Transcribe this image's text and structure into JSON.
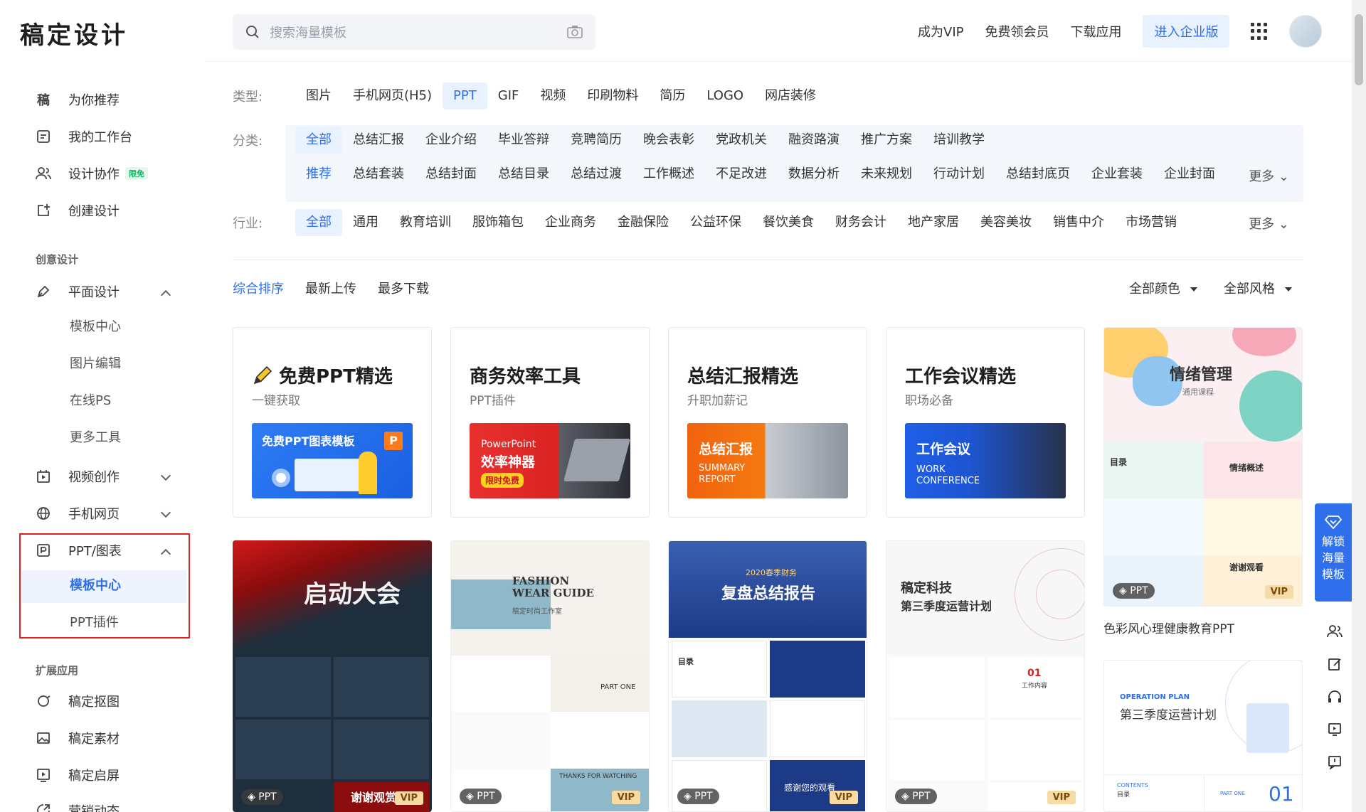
{
  "header": {
    "logo": "稿定设计",
    "search_placeholder": "搜索海量模板",
    "links": [
      "成为VIP",
      "免费领会员",
      "下载应用"
    ],
    "enterprise_button": "进入企业版"
  },
  "sidebar": {
    "top_items": [
      {
        "label": "为你推荐",
        "icon": "gao-logo-icon"
      },
      {
        "label": "我的工作台",
        "icon": "workspace-icon"
      },
      {
        "label": "设计协作",
        "icon": "users-icon",
        "badge": "限免"
      },
      {
        "label": "创建设计",
        "icon": "create-icon"
      }
    ],
    "group_creative": "创意设计",
    "flat_design": {
      "label": "平面设计",
      "subs": [
        "模板中心",
        "图片编辑",
        "在线PS",
        "更多工具"
      ]
    },
    "video": "视频创作",
    "mobile_web": "手机网页",
    "ppt": {
      "label": "PPT/图表",
      "subs": [
        "模板中心",
        "PPT插件"
      ]
    },
    "group_ext": "扩展应用",
    "ext_items": [
      "稿定抠图",
      "稿定素材",
      "稿定启屏",
      "营销动态"
    ]
  },
  "filters": {
    "type_label": "类型:",
    "types": [
      "图片",
      "手机网页(H5)",
      "PPT",
      "GIF",
      "视频",
      "印刷物料",
      "简历",
      "LOGO",
      "网店装修"
    ],
    "type_selected": 2,
    "category_label": "分类:",
    "categories_row1": [
      "全部",
      "总结汇报",
      "企业介绍",
      "毕业答辩",
      "竞聘简历",
      "晚会表彰",
      "党政机关",
      "融资路演",
      "推广方案",
      "培训教学"
    ],
    "categories_row2": [
      "推荐",
      "总结套装",
      "总结封面",
      "总结目录",
      "总结过渡",
      "工作概述",
      "不足改进",
      "数据分析",
      "未来规划",
      "行动计划",
      "总结封底页",
      "企业套装",
      "企业封面"
    ],
    "more": "更多",
    "industry_label": "行业:",
    "industries": [
      "全部",
      "通用",
      "教育培训",
      "服饰箱包",
      "企业商务",
      "金融保险",
      "公益环保",
      "餐饮美食",
      "财务会计",
      "地产家居",
      "美容美妆",
      "销售中介",
      "市场营销"
    ]
  },
  "sort": {
    "options": [
      "综合排序",
      "最新上传",
      "最多下载"
    ],
    "color_dropdown": "全部颜色",
    "style_dropdown": "全部风格"
  },
  "feature_cards": [
    {
      "title": "免费PPT精选",
      "sub": "一键获取",
      "banner": "免费PPT图表模板",
      "banner_letter": "P"
    },
    {
      "title": "商务效率工具",
      "sub": "PPT插件",
      "banner": "PowerPoint",
      "banner2": "效率神器",
      "banner3": "限时免费"
    },
    {
      "title": "总结汇报精选",
      "sub": "升职加薪记",
      "banner": "总结汇报",
      "banner2": "SUMMARY",
      "banner3": "REPORT"
    },
    {
      "title": "工作会议精选",
      "sub": "职场必备",
      "banner": "工作会议",
      "banner2": "WORK",
      "banner3": "CONFERENCE"
    }
  ],
  "templates": [
    {
      "ppt": "PPT",
      "vip": "VIP",
      "title": "情绪管理",
      "sub": "通用课程",
      "extra1": "目录",
      "extra2": "情绪概述",
      "extra3": "谢谢观看",
      "caption": "色彩风心理健康教育PPT"
    },
    {
      "ppt": "PPT",
      "vip": "VIP",
      "title": "启动大会",
      "extra1": "谢谢观赏"
    },
    {
      "ppt": "PPT",
      "vip": "VIP",
      "title": "FASHION WEAR GUIDE",
      "sub": "稿定时尚工作室",
      "extra1": "PART ONE",
      "extra2": "THANKS FOR WATCHING"
    },
    {
      "ppt": "PPT",
      "vip": "VIP",
      "title": "复盘总结报告",
      "sub": "2020春季财务",
      "extra1": "目录",
      "extra2": "感谢您的观看"
    },
    {
      "ppt": "PPT",
      "vip": "VIP",
      "title": "稿定科技",
      "sub": "第三季度运营计划",
      "extra1": "01",
      "extra2": "工作内容"
    },
    {
      "title": "第三季度运营计划",
      "sub": "OPERATION PLAN",
      "extra1": "CONTENTS",
      "extra2": "目录",
      "extra3": "PART ONE",
      "extra4": "01"
    }
  ],
  "right_float": {
    "unlock": [
      "解锁",
      "海量",
      "模板"
    ]
  },
  "colors": {
    "accent": "#2f6feb",
    "active_outline": "#e02020",
    "vip": "#f6dca4"
  }
}
